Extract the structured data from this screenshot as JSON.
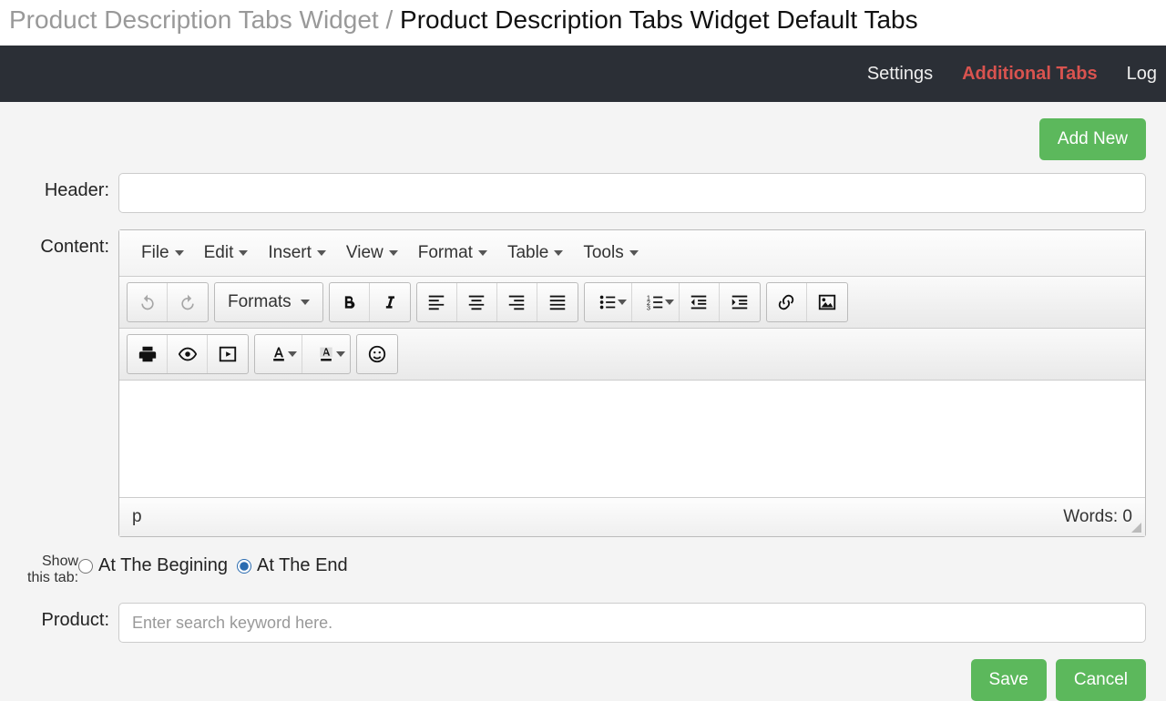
{
  "breadcrumb": {
    "parent": "Product Description Tabs Widget",
    "separator": "/",
    "current": "Product Description Tabs Widget Default Tabs"
  },
  "nav": {
    "settings": "Settings",
    "additional_tabs": "Additional Tabs",
    "log": "Log"
  },
  "buttons": {
    "add_new": "Add New",
    "save": "Save",
    "cancel": "Cancel"
  },
  "labels": {
    "header": "Header:",
    "content": "Content:",
    "show_this_tab_line1": "Show",
    "show_this_tab_line2": "this tab:",
    "product": "Product:"
  },
  "editor": {
    "menus": [
      "File",
      "Edit",
      "Insert",
      "View",
      "Format",
      "Table",
      "Tools"
    ],
    "formats_label": "Formats",
    "status_path": "p",
    "words_label": "Words:",
    "words_count": 0
  },
  "radio": {
    "at_beginning": "At The Begining",
    "at_end": "At The End",
    "selected": "end"
  },
  "product_placeholder": "Enter search keyword here.",
  "icons": {
    "undo": "undo",
    "redo": "redo",
    "bold": "bold",
    "italic": "italic",
    "align_left": "align-left",
    "align_center": "align-center",
    "align_right": "align-right",
    "justify": "justify",
    "bullets": "bullet-list",
    "numbered": "numbered-list",
    "outdent": "outdent",
    "indent": "indent",
    "link": "link",
    "image": "image",
    "print": "print",
    "preview": "preview",
    "media": "media",
    "textcolor": "text-color",
    "bgcolor": "bg-color",
    "emoji": "emoji"
  }
}
